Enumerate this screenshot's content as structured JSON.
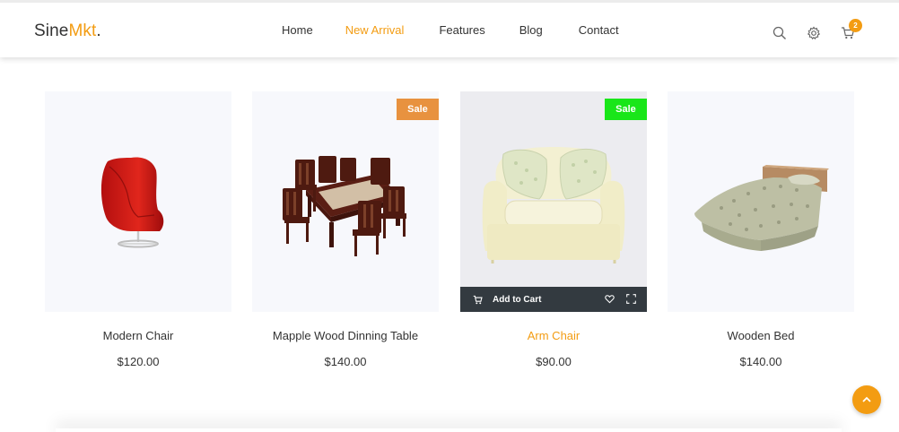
{
  "brand": {
    "name": "Sine",
    "accent": "Mkt",
    "dot": "."
  },
  "nav": [
    {
      "label": "Home",
      "active": false
    },
    {
      "label": "New Arrival",
      "active": true
    },
    {
      "label": "Features",
      "active": false
    },
    {
      "label": "Blog",
      "active": false
    },
    {
      "label": "Contact",
      "active": false
    }
  ],
  "header_icons": [
    "search-icon",
    "gear-icon",
    "cart-icon"
  ],
  "cart": {
    "count": "2"
  },
  "products": [
    {
      "name": "Modern Chair",
      "price": "$120.00",
      "badge": "",
      "image": "egg-chair"
    },
    {
      "name": "Mapple Wood Dinning Table",
      "price": "$140.00",
      "badge": "Sale",
      "badge_color": "#e8923f",
      "image": "dining-table"
    },
    {
      "name": "Arm Chair",
      "price": "$90.00",
      "badge": "Sale",
      "badge_color": "#19e619",
      "image": "arm-chair",
      "hovered": true
    },
    {
      "name": "Wooden Bed",
      "price": "$140.00",
      "badge": "",
      "image": "bed"
    }
  ],
  "action_bar": {
    "add_to_cart": "Add to Cart",
    "icons": [
      "cart-icon",
      "heart-icon",
      "expand-icon"
    ]
  },
  "colors": {
    "accent": "#f39c12",
    "text": "#333333",
    "card_bg": "#f7f8fc",
    "action_bar": "#333a40"
  }
}
